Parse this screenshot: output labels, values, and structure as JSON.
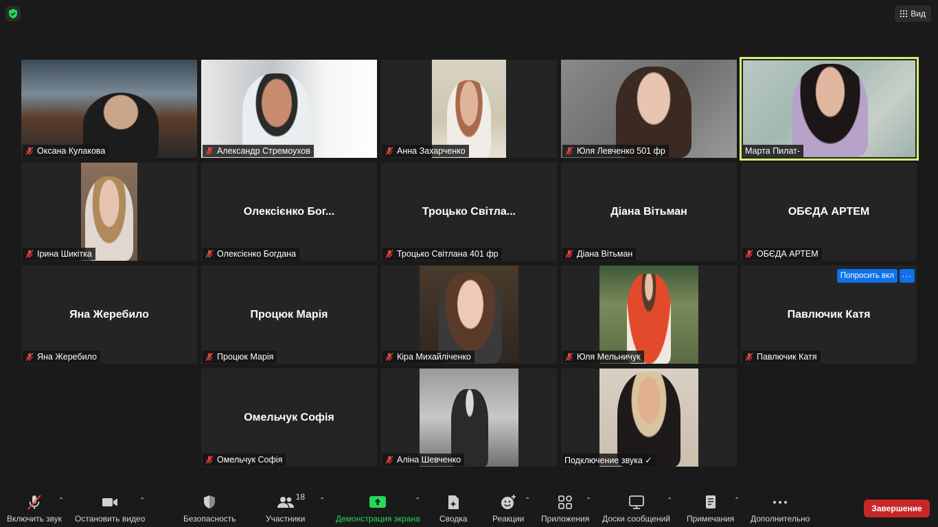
{
  "top": {
    "view_label": "Вид"
  },
  "tiles": {
    "t1": {
      "name": "Оксана Кулакова"
    },
    "t2": {
      "name": "Александр Стремоухов"
    },
    "t3": {
      "name": "Анна Захарченко"
    },
    "t4": {
      "name": "Юля Левченко 501 фр"
    },
    "t5": {
      "name": "Марта Пилат-"
    },
    "t6": {
      "name": "Ірина Шикітка"
    },
    "t7": {
      "name": "Олексієнко Богдана",
      "center": "Олексієнко Бог..."
    },
    "t8": {
      "name": "Троцько Світлана 401 фр",
      "center": "Троцько  Світла..."
    },
    "t9": {
      "name": "Діана Вітьман",
      "center": "Діана Вітьман"
    },
    "t10": {
      "name": "ОБЄДА АРТЕМ",
      "center": "ОБЄДА АРТЕМ"
    },
    "t11": {
      "name": "Яна Жеребило",
      "center": "Яна Жеребило"
    },
    "t12": {
      "name": "Процюк Марія",
      "center": "Процюк Марія"
    },
    "t13": {
      "name": "Кіра Михайліченко"
    },
    "t14": {
      "name": "Юля Мельничук"
    },
    "t15": {
      "name": "Павлючик Катя",
      "center": "Павлючик Катя",
      "ask_label": "Попросить вкл",
      "more_label": "···"
    },
    "t16": {
      "name": "Омельчук Софія",
      "center": "Омельчук Софія"
    },
    "t17": {
      "name": "Аліна Шевченко"
    },
    "t18": {
      "name": "Подключение звука ✓"
    }
  },
  "toolbar": {
    "unmute": "Включить звук",
    "video": "Остановить видео",
    "security": "Безопасность",
    "participants": "Участники",
    "participants_count": "18",
    "share": "Демонстрация экрана",
    "summary": "Сводка",
    "reactions": "Реакции",
    "apps": "Приложения",
    "whiteboards": "Доски сообщений",
    "notes": "Примечания",
    "more": "Дополнительно",
    "end": "Завершение",
    "caret": "⌃"
  },
  "colors": {
    "accent_green": "#23d959",
    "end_red": "#c62828",
    "active_outline": "#d6f073",
    "ask_blue": "#0e71eb"
  }
}
